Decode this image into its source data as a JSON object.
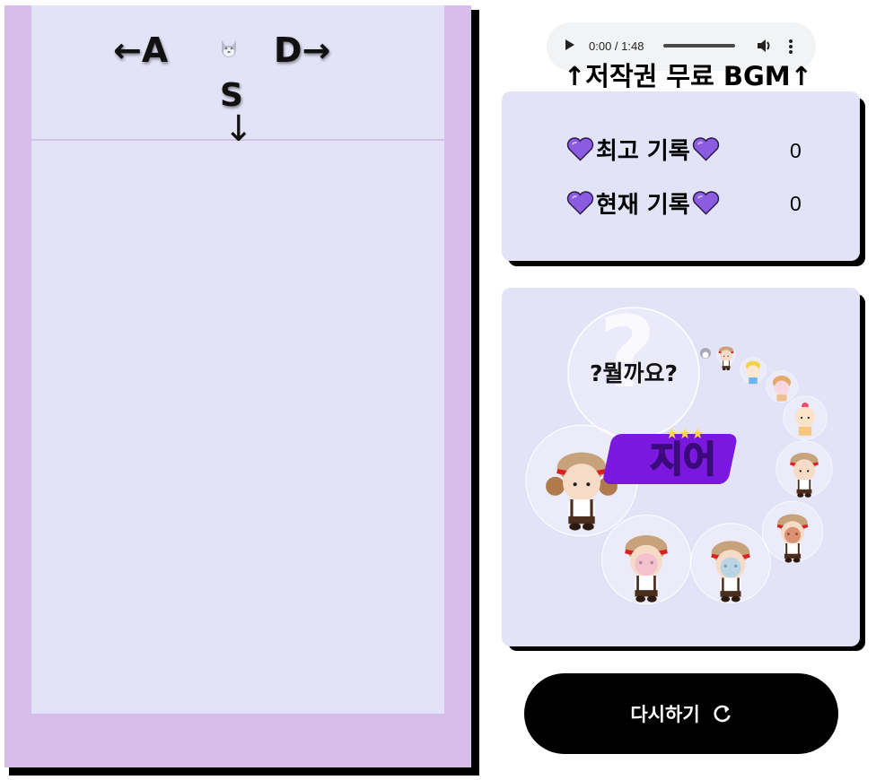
{
  "game": {
    "controls": {
      "left_label": "←A",
      "right_label": "D→",
      "drop_label": "S",
      "drop_arrow": "↓"
    },
    "next_piece_icon": "husky-icon"
  },
  "audio": {
    "time_display": "0:00 / 1:48",
    "progress": 0,
    "caption": "↑저작권 무료 BGM↑"
  },
  "scores": {
    "best_label": "최고 기록",
    "best_value": "0",
    "current_label": "현재 기록",
    "current_value": "0",
    "heart_color": "#8b5be0"
  },
  "evolution": {
    "mystery_label": "?뭘까요?",
    "logo_text": "지어"
  },
  "restart": {
    "label": "다시하기",
    "icon": "refresh-icon"
  },
  "colors": {
    "board_border": "#d6bdea",
    "playfield": "#e3e3f8",
    "panel_bg": "#e3e3f8",
    "button_bg": "#000000"
  }
}
